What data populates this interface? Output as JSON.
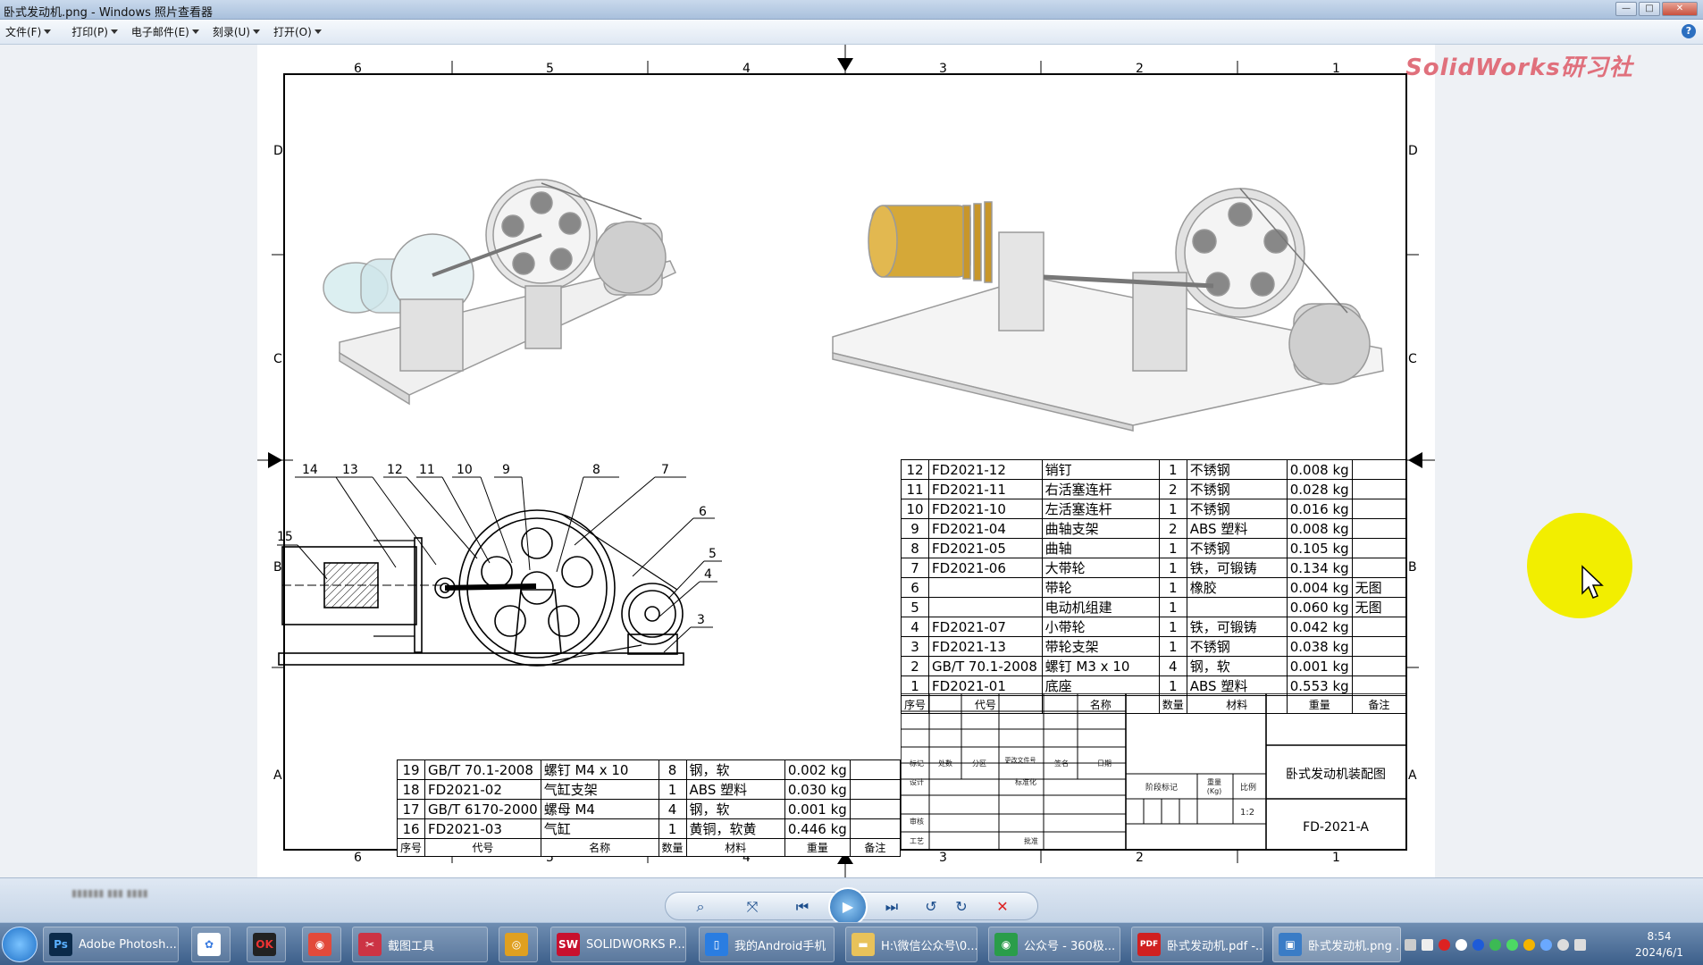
{
  "window": {
    "title": "卧式发动机.png - Windows 照片查看器",
    "buttons": [
      "—",
      "□",
      "✕"
    ]
  },
  "menu": {
    "items": [
      {
        "label": "文件(F)",
        "name": "menu-file"
      },
      {
        "label": "打印(P)",
        "name": "menu-print"
      },
      {
        "label": "电子邮件(E)",
        "name": "menu-email"
      },
      {
        "label": "刻录(U)",
        "name": "menu-burn"
      },
      {
        "label": "打开(O)",
        "name": "menu-open"
      }
    ],
    "help": "?"
  },
  "watermark": "SolidWorks研习社",
  "drawing": {
    "border_columns": [
      "6",
      "5",
      "4",
      "3",
      "2",
      "1"
    ],
    "border_rows": [
      "D",
      "C",
      "B",
      "A"
    ],
    "balloons": [
      "14",
      "13",
      "12",
      "11",
      "10",
      "9",
      "8",
      "7",
      "6",
      "5",
      "4",
      "3",
      "15"
    ]
  },
  "bom_main": {
    "rows": [
      [
        "12",
        "FD2021-12",
        "销钉",
        "1",
        "不锈钢",
        "0.008 kg",
        ""
      ],
      [
        "11",
        "FD2021-11",
        "右活塞连杆",
        "2",
        "不锈钢",
        "0.028 kg",
        ""
      ],
      [
        "10",
        "FD2021-10",
        "左活塞连杆",
        "1",
        "不锈钢",
        "0.016 kg",
        ""
      ],
      [
        "9",
        "FD2021-04",
        "曲轴支架",
        "2",
        "ABS 塑料",
        "0.008 kg",
        ""
      ],
      [
        "8",
        "FD2021-05",
        "曲轴",
        "1",
        "不锈钢",
        "0.105 kg",
        ""
      ],
      [
        "7",
        "FD2021-06",
        "大带轮",
        "1",
        "铁，可锻铸",
        "0.134 kg",
        ""
      ],
      [
        "6",
        "",
        "带轮",
        "1",
        "橡胶",
        "0.004 kg",
        "无图"
      ],
      [
        "5",
        "",
        "电动机组建",
        "1",
        "",
        "0.060 kg",
        "无图"
      ],
      [
        "4",
        "FD2021-07",
        "小带轮",
        "1",
        "铁，可锻铸",
        "0.042 kg",
        ""
      ],
      [
        "3",
        "FD2021-13",
        "带轮支架",
        "1",
        "不锈钢",
        "0.038 kg",
        ""
      ],
      [
        "2",
        "GB/T 70.1-2008",
        "螺钉 M3 x 10",
        "4",
        "钢，软",
        "0.001 kg",
        ""
      ],
      [
        "1",
        "FD2021-01",
        "底座",
        "1",
        "ABS 塑料",
        "0.553 kg",
        ""
      ]
    ],
    "header": [
      "序号",
      "代号",
      "名称",
      "数量",
      "材料",
      "重量",
      "备注"
    ]
  },
  "bom_lower": {
    "rows": [
      [
        "19",
        "GB/T 70.1-2008",
        "螺钉 M4 x 10",
        "8",
        "钢，软",
        "0.002 kg",
        ""
      ],
      [
        "18",
        "FD2021-02",
        "气缸支架",
        "1",
        "ABS 塑料",
        "0.030 kg",
        ""
      ],
      [
        "17",
        "GB/T 6170-2000",
        "螺母  M4",
        "4",
        "钢，软",
        "0.001 kg",
        ""
      ],
      [
        "16",
        "FD2021-03",
        "气缸",
        "1",
        "黄铜，软黄",
        "0.446 kg",
        ""
      ]
    ],
    "header": [
      "序号",
      "代号",
      "名称",
      "数量",
      "材料",
      "重量",
      "备注"
    ]
  },
  "title_block": {
    "name": "卧式发动机装配图",
    "code": "FD-2021-A",
    "scale": "1:2",
    "scale_label": "比例",
    "weight_label": "重量\n(Kg)",
    "stage_label": "阶段标记",
    "small_labels": [
      "标记",
      "处数",
      "分区",
      "更改文件号",
      "签名",
      "日期",
      "设计",
      "标准化",
      "审核",
      "工艺",
      "批准"
    ]
  },
  "toolbar": {
    "buttons": [
      "⌕",
      "⤧",
      "⏮",
      "▶",
      "⏭",
      "↺",
      "↻",
      "✕"
    ]
  },
  "taskbar": {
    "items": [
      {
        "label": "Adobe Photosh...",
        "icon": "Ps",
        "color": "#0b2a4a"
      },
      {
        "label": "",
        "icon": "✿",
        "color": "#ffffff"
      },
      {
        "label": "",
        "icon": "OK",
        "color": "#222222"
      },
      {
        "label": "",
        "icon": "◉",
        "color": "#e24a3b"
      },
      {
        "label": "截图工具",
        "icon": "✂",
        "color": "#cc3344"
      },
      {
        "label": "",
        "icon": "◎",
        "color": "#e0a020"
      },
      {
        "label": "SOLIDWORKS P...",
        "icon": "SW",
        "color": "#c8102e"
      },
      {
        "label": "我的Android手机",
        "icon": "▯",
        "color": "#2a7de1"
      },
      {
        "label": "H:\\微信公众号\\0...",
        "icon": "▬",
        "color": "#e8c25a"
      },
      {
        "label": "公众号 - 360极...",
        "icon": "◉",
        "color": "#2a9d4a"
      },
      {
        "label": "卧式发动机.pdf -...",
        "icon": "PDF",
        "color": "#d02020"
      },
      {
        "label": "卧式发动机.png ...",
        "icon": "▣",
        "color": "#3a7cc6"
      }
    ],
    "clock_time": "8:54",
    "clock_date": "2024/6/1"
  }
}
